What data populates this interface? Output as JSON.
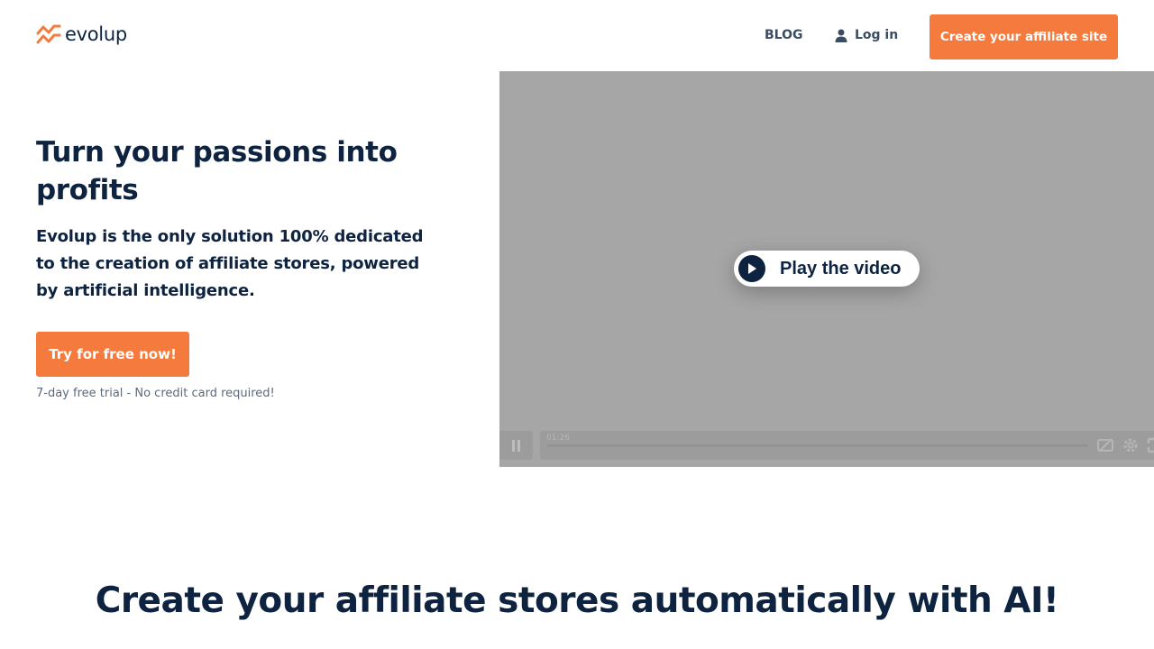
{
  "brand": {
    "name": "evolup",
    "accent_color": "#f47b3d",
    "text_color": "#0d2340"
  },
  "nav": {
    "blog": "BLOG",
    "login": "Log in",
    "cta": "Create your affiliate site"
  },
  "hero": {
    "title": "Turn your passions into profits",
    "subtitle": "Evolup is the only solution 100% dedicated to the creation of affiliate stores, powered by artificial intelligence.",
    "cta": "Try for free now!",
    "note": "7-day free trial - No credit card required!"
  },
  "video": {
    "play_label": "Play the video",
    "time": "01:26",
    "icons": [
      "pause-icon",
      "captions-off-icon",
      "settings-icon",
      "fullscreen-icon"
    ]
  },
  "section": {
    "title": "Create your affiliate stores automatically with AI!"
  }
}
